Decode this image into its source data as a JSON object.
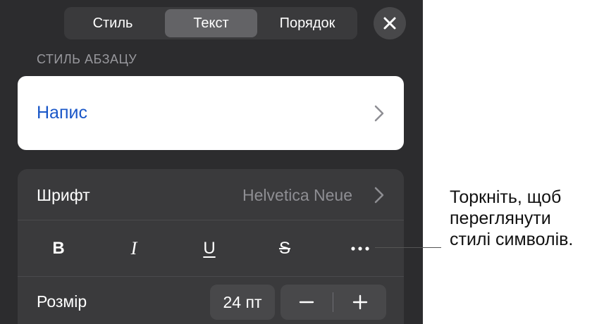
{
  "tabs": [
    {
      "label": "Стиль",
      "selected": false
    },
    {
      "label": "Текст",
      "selected": true
    },
    {
      "label": "Порядок",
      "selected": false
    }
  ],
  "close_icon": "xmark-icon",
  "paragraph_style": {
    "header": "СТИЛЬ АБЗАЦУ",
    "value": "Напис"
  },
  "font": {
    "label": "Шрифт",
    "value": "Helvetica Neue"
  },
  "format_buttons": [
    {
      "label": "B",
      "name": "bold"
    },
    {
      "label": "I",
      "name": "italic"
    },
    {
      "label": "U",
      "name": "underline"
    },
    {
      "label": "S",
      "name": "strikethrough"
    }
  ],
  "more_icon": "ellipsis-icon",
  "size": {
    "label": "Розмір",
    "value": "24 пт"
  },
  "callout": {
    "lines": [
      "Торкніть, щоб",
      "переглянути",
      "стилі символів."
    ]
  },
  "colors": {
    "panel_bg": "#2c2c2e",
    "link_blue": "#1a57c8",
    "selected_segment": "#636366"
  }
}
